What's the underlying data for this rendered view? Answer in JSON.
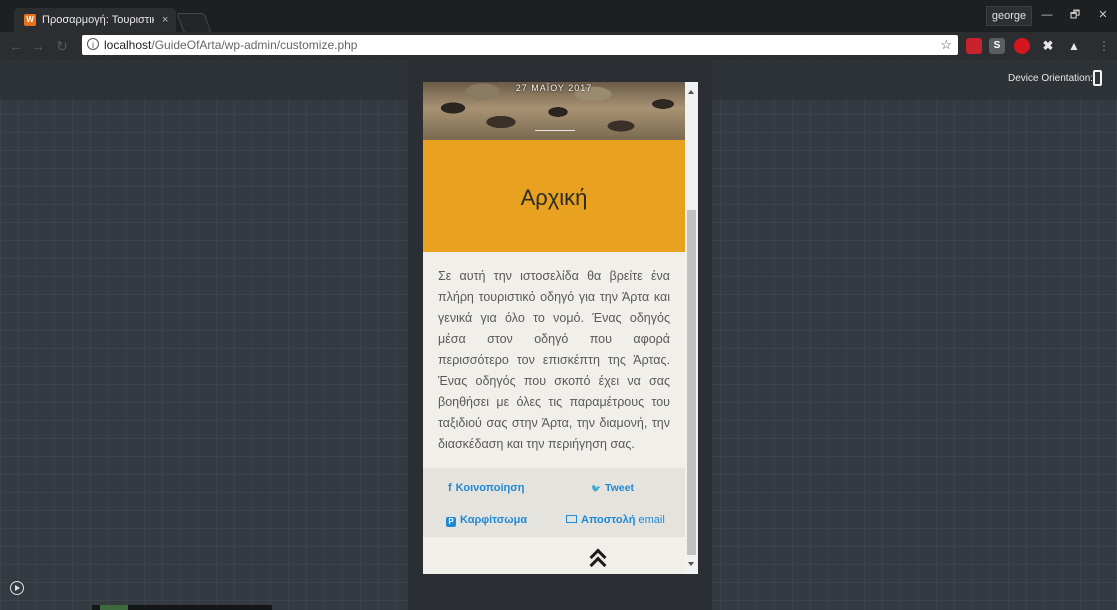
{
  "browser": {
    "tab_title": "Προσαρμογή: Τουριστικ",
    "tab_close": "×",
    "profile_name": "george",
    "window_controls": {
      "minimize": "—",
      "restore": "🗗",
      "close": "✕"
    },
    "url_host": "localhost",
    "url_path": "/GuideOfArta/wp-admin/customize.php",
    "extensions": [
      "lastpass-icon",
      "s-extension-icon",
      "opera-vpn-icon",
      "pin-extension-icon",
      "drive-icon"
    ]
  },
  "customizer": {
    "device_orientation_label": "Device Orientation:",
    "orientation_icon": "phone-portrait-icon"
  },
  "preview": {
    "hero_date": "27 ΜΑΪΟΥ 2017",
    "page_title": "Αρχική",
    "body_text": "Σε αυτή την ιστοσελίδα θα βρείτε ένα πλήρη τουριστικό οδηγό για την Άρτα και γενικά για όλο το νομό. Ένας οδηγός μέσα στον οδηγό που αφορά περισσότερο τον επισκέπτη της Άρτας. Ένας οδηγός που σκοπό έχει να σας βοηθήσει με όλες τις παραμέτρους του ταξιδιού σας στην Άρτα, την διαμονή, την διασκέδαση και την περιήγηση σας.",
    "share": {
      "facebook_icon": "f",
      "facebook_label": "Κοινοποίηση",
      "twitter_icon": "🐦",
      "twitter_label": "Tweet",
      "pinterest_icon": "P",
      "pinterest_label": "Καρφίτσωμα",
      "email_label": "Αποστολή",
      "email_suffix": "email"
    }
  },
  "colors": {
    "accent_band": "#e8a21f",
    "share_link": "#1e8ad6",
    "canvas": "#343a41"
  }
}
